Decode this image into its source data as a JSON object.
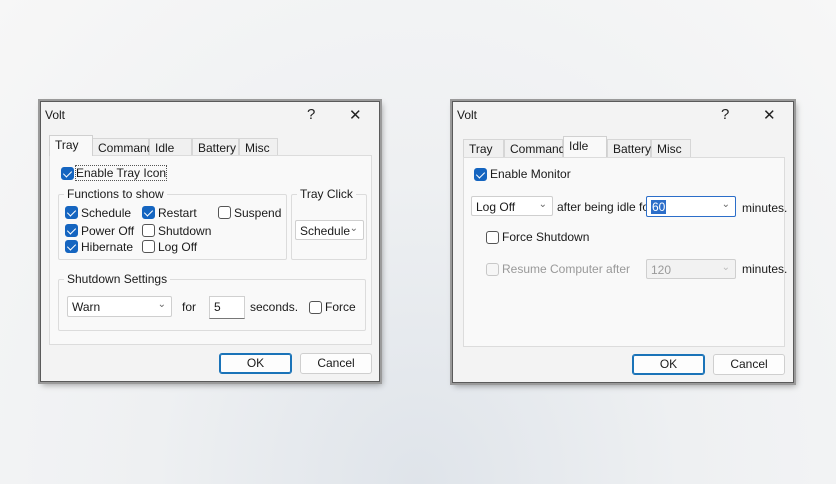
{
  "left_dialog": {
    "title": "Volt",
    "help": "?",
    "close": "✕",
    "tabs": [
      "Tray",
      "Command",
      "Idle",
      "Battery",
      "Misc"
    ],
    "enable_tray_icon": {
      "label": "Enable Tray Icon",
      "checked": true
    },
    "functions_group": "Functions to show",
    "functions": [
      {
        "label": "Schedule",
        "checked": true
      },
      {
        "label": "Restart",
        "checked": true
      },
      {
        "label": "Suspend",
        "checked": false
      },
      {
        "label": "Power Off",
        "checked": true
      },
      {
        "label": "Shutdown",
        "checked": false
      },
      {
        "label": "Hibernate",
        "checked": true
      },
      {
        "label": "Log Off",
        "checked": false
      }
    ],
    "tray_click_group": "Tray Click",
    "tray_click_value": "Schedule",
    "shutdown_group": "Shutdown Settings",
    "shutdown_action": "Warn",
    "for_label": "for",
    "seconds_value": "5",
    "seconds_label": "seconds.",
    "force": {
      "label": "Force",
      "checked": false
    },
    "ok": "OK",
    "cancel": "Cancel"
  },
  "right_dialog": {
    "title": "Volt",
    "help": "?",
    "close": "✕",
    "tabs": [
      "Tray",
      "Command",
      "Idle",
      "Battery",
      "Misc"
    ],
    "enable_monitor": {
      "label": "Enable Monitor",
      "checked": true
    },
    "idle_action": "Log Off",
    "after_label": "after being idle for",
    "idle_minutes": "60",
    "minutes_label": "minutes.",
    "force_shutdown": {
      "label": "Force Shutdown",
      "checked": false
    },
    "resume": {
      "label": "Resume Computer after",
      "checked": false,
      "value": "120"
    },
    "minutes_label2": "minutes.",
    "ok": "OK",
    "cancel": "Cancel"
  }
}
